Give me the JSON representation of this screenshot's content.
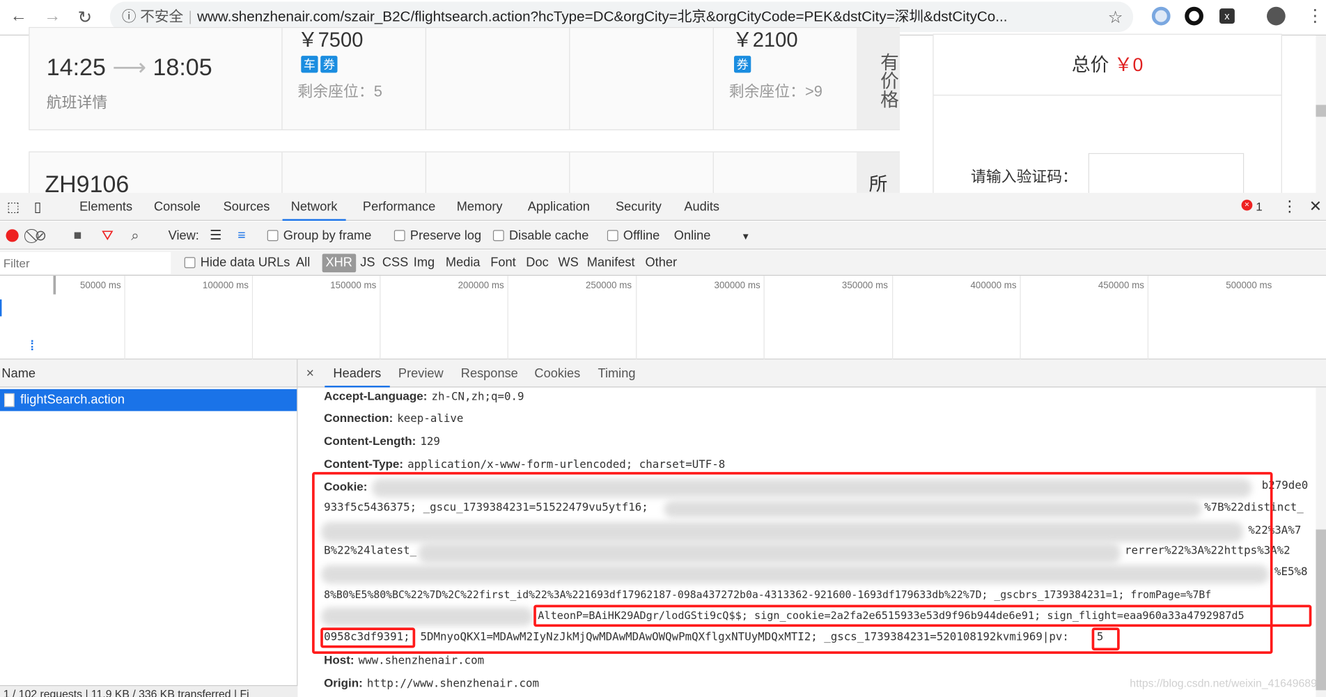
{
  "browser": {
    "url_security": "不安全",
    "url": "www.shenzhenair.com/szair_B2C/flightsearch.action?hcType=DC&orgCity=北京&orgCityCode=PEK&dstCity=深圳&dstCityCo...",
    "icons": [
      "back-icon",
      "forward-icon",
      "reload-icon",
      "info-icon",
      "star-icon",
      "extension-icon",
      "account-icon",
      "menu-icon"
    ]
  },
  "page": {
    "flight1": {
      "depart": "14:25",
      "arrive": "18:05",
      "details": "航班详情",
      "price1": "￥7500",
      "badges1": [
        "车",
        "券"
      ],
      "seats1": "剩余座位：5",
      "price2": "￥2100",
      "badges2": [
        "券"
      ],
      "seats2": "剩余座位：>9",
      "more": "有价格"
    },
    "flight2": {
      "number": "ZH9106",
      "more": "所"
    },
    "side": {
      "total_label": "总价",
      "total_value": "￥0",
      "captcha_label": "请输入验证码："
    }
  },
  "devtools": {
    "tabs": [
      "Elements",
      "Console",
      "Sources",
      "Network",
      "Performance",
      "Memory",
      "Application",
      "Security",
      "Audits"
    ],
    "active_tab": "Network",
    "error_count": "1",
    "toolbar": {
      "view": "View:",
      "group_by_frame": "Group by frame",
      "preserve_log": "Preserve log",
      "disable_cache": "Disable cache",
      "offline": "Offline",
      "throttle": "Online"
    },
    "filter": {
      "placeholder": "Filter",
      "hide_data_urls": "Hide data URLs",
      "types": [
        "All",
        "XHR",
        "JS",
        "CSS",
        "Img",
        "Media",
        "Font",
        "Doc",
        "WS",
        "Manifest",
        "Other"
      ],
      "active_type": "XHR"
    },
    "timeline_ticks": [
      "50000 ms",
      "100000 ms",
      "150000 ms",
      "200000 ms",
      "250000 ms",
      "300000 ms",
      "350000 ms",
      "400000 ms",
      "450000 ms",
      "500000 ms"
    ],
    "name_header": "Name",
    "requests": [
      {
        "name": "flightSearch.action"
      }
    ],
    "status": "1 / 102 requests | 11.9 KB / 336 KB transferred | Fi",
    "detail_tabs": [
      "Headers",
      "Preview",
      "Response",
      "Cookies",
      "Timing"
    ],
    "active_detail_tab": "Headers",
    "headers": [
      {
        "k": "Accept-Language:",
        "v": "zh-CN,zh;q=0.9"
      },
      {
        "k": "Connection:",
        "v": "keep-alive"
      },
      {
        "k": "Content-Length:",
        "v": "129"
      },
      {
        "k": "Content-Type:",
        "v": "application/x-www-form-urlencoded; charset=UTF-8"
      }
    ],
    "cookie": {
      "key": "Cookie:",
      "lines": [
        "b279de0",
        "933f5c5436375; _gscu_1739384231=51522479vu5ytf16;",
        "%7B%22distinct_",
        "%22%3A%7",
        "B%22%24latest_",
        "rerrer%22%3A%22https%3A%2",
        "%E5%8",
        "8%B0%E5%80%BC%22%7D%2C%22first_id%22%3A%221693df17962187-098a437272b0a-4313362-921600-1693df179633db%22%7D; _gscbrs_1739384231=1; fromPage=%7Bf",
        "AlteonP=BAiHK29ADgr/lodGSti9cQ$$; sign_cookie=2a2fa2e6515933e53d9f96b944de6e91; sign_flight=eaa960a33a4792987d5",
        "0958c3df9391;",
        "5DMnyoQKX1=MDAwM2IyNzJkMjQwMDAwMDAwOWQwPmQXflgxNTUyMDQxMTI2; _gscs_1739384231=520108192kvmi969|pv:",
        "5"
      ]
    },
    "after": [
      {
        "k": "Host:",
        "v": "www.shenzhenair.com"
      },
      {
        "k": "Origin:",
        "v": "http://www.shenzhenair.com"
      }
    ]
  },
  "watermark": "https://blog.csdn.net/weixin_41649689",
  "colors": {
    "accent": "#1a73e8",
    "highlight": "#ff1a1a",
    "price": "#e02020",
    "badge": "#1a8de0"
  }
}
